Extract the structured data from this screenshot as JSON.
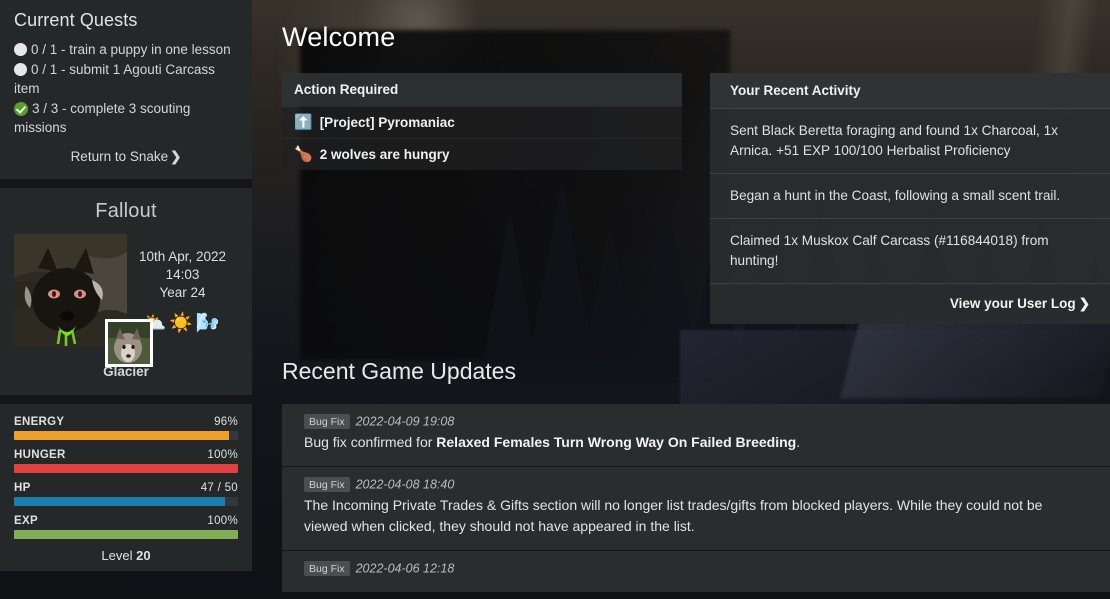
{
  "sidebar": {
    "quests": {
      "title": "Current Quests",
      "items": [
        {
          "icon": "circle-empty-icon",
          "status": "incomplete",
          "text": "0 / 1 - train a puppy in one lesson"
        },
        {
          "icon": "circle-empty-icon",
          "status": "incomplete",
          "text": "0 / 1 - submit 1 Agouti Carcass item"
        },
        {
          "icon": "circle-check-icon",
          "status": "complete",
          "text": "3 / 3 - complete 3 scouting missions"
        }
      ],
      "return_link": "Return to Snake",
      "chevron": "❯"
    },
    "character": {
      "name": "Fallout",
      "date": "10th Apr, 2022",
      "time": "14:03",
      "year": "Year 24",
      "weather": [
        "⛅",
        "☀️",
        "🌬️"
      ],
      "location": "Glacier"
    },
    "stats": {
      "bars": [
        {
          "label": "ENERGY",
          "value": "96%",
          "pct": 96,
          "color": "#eda02c"
        },
        {
          "label": "HUNGER",
          "value": "100%",
          "pct": 100,
          "color": "#e04141"
        },
        {
          "label": "HP",
          "value": "47 / 50",
          "pct": 94,
          "color": "#1b7ead"
        },
        {
          "label": "EXP",
          "value": "100%",
          "pct": 100,
          "color": "#81ae55"
        }
      ],
      "level_prefix": "Level ",
      "level": "20"
    }
  },
  "main": {
    "page_title": "Welcome",
    "action_required": {
      "heading": "Action Required",
      "items": [
        {
          "icon": "⬆️",
          "icon_name": "green-up-arrow-icon",
          "label": "[Project] Pyromaniac"
        },
        {
          "icon": "🍗",
          "icon_name": "meat-drumstick-icon",
          "label": "2 wolves are hungry"
        }
      ]
    },
    "activity": {
      "heading": "Your Recent Activity",
      "entries": [
        "Sent Black Beretta foraging and found 1x Charcoal, 1x Arnica. +51 EXP 100/100 Herbalist Proficiency",
        "Began a hunt in the Coast, following a small scent trail.",
        "Claimed 1x Muskox Calf Carcass (#116844018) from hunting!"
      ],
      "footer_link": "View your User Log",
      "chevron": "❯"
    },
    "updates": {
      "heading": "Recent Game Updates",
      "rows": [
        {
          "tag": "Bug Fix",
          "timestamp": "2022-04-09 19:08",
          "text_before": "Bug fix confirmed for ",
          "text_bold": "Relaxed Females Turn Wrong Way On Failed Breeding",
          "text_after": "."
        },
        {
          "tag": "Bug Fix",
          "timestamp": "2022-04-08 18:40",
          "text_before": "The Incoming Private Trades & Gifts section will no longer list trades/gifts from blocked players. While they could not be viewed when clicked, they should not have appeared in the list.",
          "text_bold": "",
          "text_after": ""
        },
        {
          "tag": "Bug Fix",
          "timestamp": "2022-04-06 12:18",
          "text_before": "",
          "text_bold": "",
          "text_after": ""
        }
      ]
    }
  }
}
